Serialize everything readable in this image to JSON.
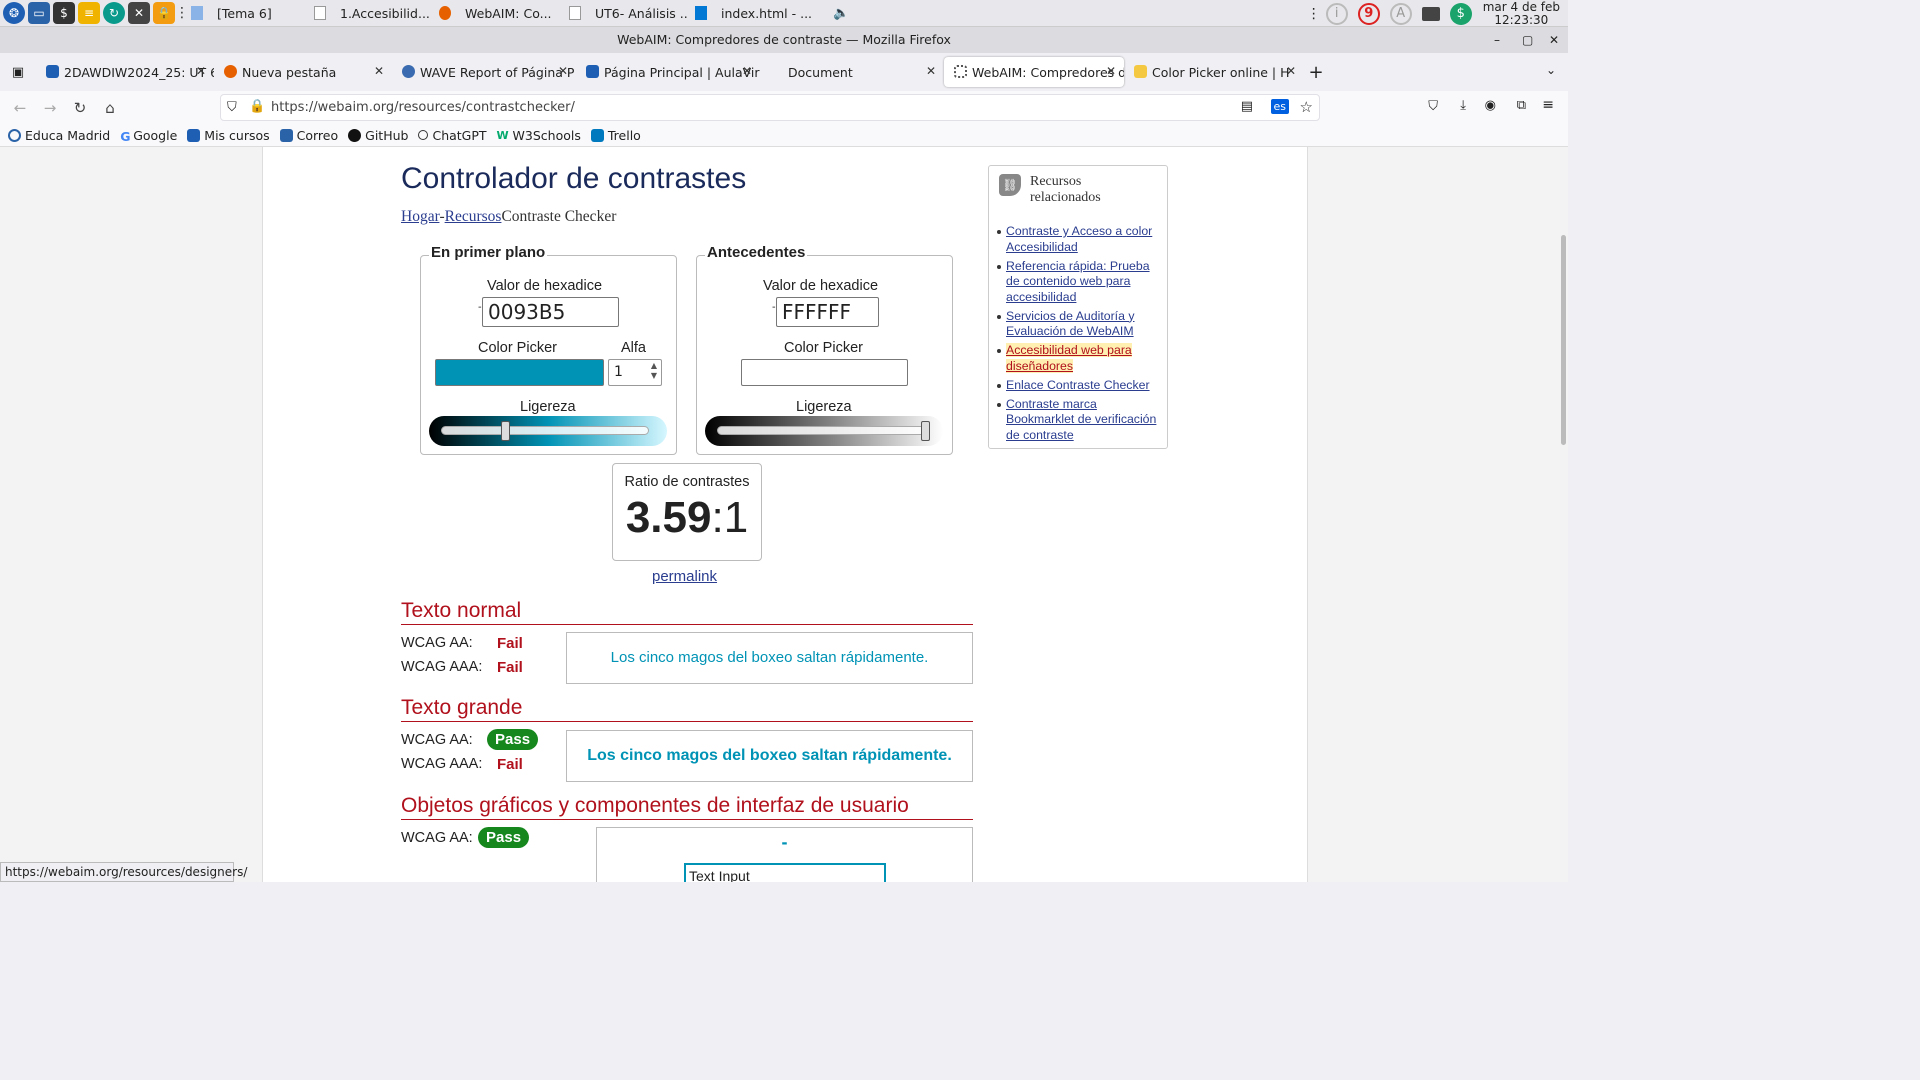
{
  "taskbar": {
    "tasks": [
      "[Tema 6]",
      "1.Accesibilid...",
      "WebAIM: Co...",
      "UT6- Análisis ...",
      "index.html - ..."
    ],
    "notifications": "9",
    "clock_date": "mar 4 de feb",
    "clock_time": "12:23:30"
  },
  "window": {
    "title": "WebAIM: Compredores de contraste — Mozilla Firefox"
  },
  "tabs": [
    {
      "label": "2DAWDIW2024_25: UT 6"
    },
    {
      "label": "Nueva pestaña"
    },
    {
      "label": "WAVE Report of Página P"
    },
    {
      "label": "Página Principal | AulaVir"
    },
    {
      "label": "Document"
    },
    {
      "label": "WebAIM: Compredores d"
    },
    {
      "label": "Color Picker online | H"
    }
  ],
  "address": {
    "url": "https://webaim.org/resources/contrastchecker/",
    "lang": "es"
  },
  "bookmarks": [
    "Educa Madrid",
    "Google",
    "Mis cursos",
    "Correo",
    "GitHub",
    "ChatGPT",
    "W3Schools",
    "Trello"
  ],
  "page": {
    "title": "Controlador de contrastes",
    "breadcrumb": {
      "home": "Hogar",
      "sep": "-",
      "resources": "Recursos",
      "current": "Contraste Checker"
    },
    "foreground": {
      "legend": "En primer plano",
      "hex_label": "Valor de hexadice",
      "hex_value": "0093B5",
      "picker_label": "Color Picker",
      "alpha_label": "Alfa",
      "alpha_value": "1",
      "lightness_label": "Ligereza",
      "lightness_level": 0.31,
      "color": "#0093B5"
    },
    "background": {
      "legend": "Antecedentes",
      "hex_label": "Valor de hexadice",
      "hex_value": "FFFFFF",
      "picker_label": "Color Picker",
      "lightness_label": "Ligereza",
      "lightness_level": 1.0,
      "color": "#FFFFFF"
    },
    "ratio": {
      "label": "Ratio de contrastes",
      "value": "3.59",
      "suffix": ":1"
    },
    "permalink": "permalink",
    "normal": {
      "heading": "Texto normal",
      "aa_label": "WCAG AA:",
      "aa_result": "Fail",
      "aaa_label": "WCAG AAA:",
      "aaa_result": "Fail",
      "sample": "Los cinco magos del boxeo saltan rápidamente."
    },
    "large": {
      "heading": "Texto grande",
      "aa_label": "WCAG AA:",
      "aa_result": "Pass",
      "aaa_label": "WCAG AAA:",
      "aaa_result": "Fail",
      "sample": "Los cinco magos del boxeo saltan rápidamente."
    },
    "graphics": {
      "heading": "Objetos gráficos y componentes de interfaz de usuario",
      "aa_label": "WCAG AA:",
      "aa_result": "Pass",
      "input_text": "Text Input",
      "dash": "-"
    },
    "related": {
      "heading_line1": "Recursos",
      "heading_line2": "relacionados",
      "links": [
        "Contraste y Acceso a color Accesibilidad",
        "Referencia rápida: Prueba de contenido web para accesibilidad",
        "Servicios de Auditoría y Evaluación de WebAIM",
        "Accesibilidad web para diseñadores",
        "Enlace Contraste Checker",
        "Contraste marca Bookmarklet de verificación de contraste"
      ]
    }
  },
  "statusbar": "https://webaim.org/resources/designers/"
}
